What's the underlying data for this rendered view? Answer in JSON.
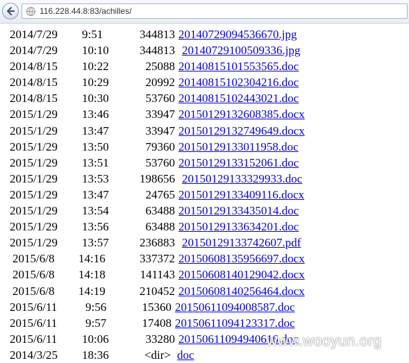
{
  "browser": {
    "address": "116.228.44.8:83/achilles/"
  },
  "listing": [
    {
      "date": "2014/7/29",
      "time": "9:51",
      "size": "344813",
      "name": "20140729094536670.jpg"
    },
    {
      "date": "2014/7/29",
      "time": "10:10",
      "size": "344813",
      "name": "20140729100509336.jpg"
    },
    {
      "date": "2014/8/15",
      "time": "10:22",
      "size": "25088",
      "name": "20140815101553565.doc"
    },
    {
      "date": "2014/8/15",
      "time": "10:29",
      "size": "20992",
      "name": "20140815102304216.doc"
    },
    {
      "date": "2014/8/15",
      "time": "10:30",
      "size": "53760",
      "name": "20140815102443021.doc"
    },
    {
      "date": "2015/1/29",
      "time": "13:46",
      "size": "33947",
      "name": "20150129132608385.docx"
    },
    {
      "date": "2015/1/29",
      "time": "13:47",
      "size": "33947",
      "name": "20150129132749649.docx"
    },
    {
      "date": "2015/1/29",
      "time": "13:50",
      "size": "79360",
      "name": "20150129133011958.doc"
    },
    {
      "date": "2015/1/29",
      "time": "13:51",
      "size": "53760",
      "name": "20150129133152061.doc"
    },
    {
      "date": "2015/1/29",
      "time": "13:53",
      "size": "198656",
      "name": "20150129133329933.doc"
    },
    {
      "date": "2015/1/29",
      "time": "13:47",
      "size": "24765",
      "name": "20150129133409116.docx"
    },
    {
      "date": "2015/1/29",
      "time": "13:54",
      "size": "63488",
      "name": "20150129133435014.doc"
    },
    {
      "date": "2015/1/29",
      "time": "13:56",
      "size": "63488",
      "name": "20150129133634201.doc"
    },
    {
      "date": "2015/1/29",
      "time": "13:57",
      "size": "236883",
      "name": "20150129133742607.pdf"
    },
    {
      "date": "2015/6/8",
      "time": "14:16",
      "size": "337372",
      "name": "20150608135956697.docx"
    },
    {
      "date": "2015/6/8",
      "time": "14:18",
      "size": "141143",
      "name": "20150608140129042.docx"
    },
    {
      "date": "2015/6/8",
      "time": "14:19",
      "size": "210452",
      "name": "20150608140256464.docx"
    },
    {
      "date": "2015/6/11",
      "time": "9:56",
      "size": "15360",
      "name": "20150611094008587.doc"
    },
    {
      "date": "2015/6/11",
      "time": "9:57",
      "size": "17408",
      "name": "20150611094123317.doc"
    },
    {
      "date": "2015/6/11",
      "time": "10:06",
      "size": "33280",
      "name": "20150611094940616.doc"
    },
    {
      "date": "2014/3/25",
      "time": "18:36",
      "size": "<dir>",
      "name": "doc"
    }
  ],
  "watermark": "www.wooyun.org"
}
